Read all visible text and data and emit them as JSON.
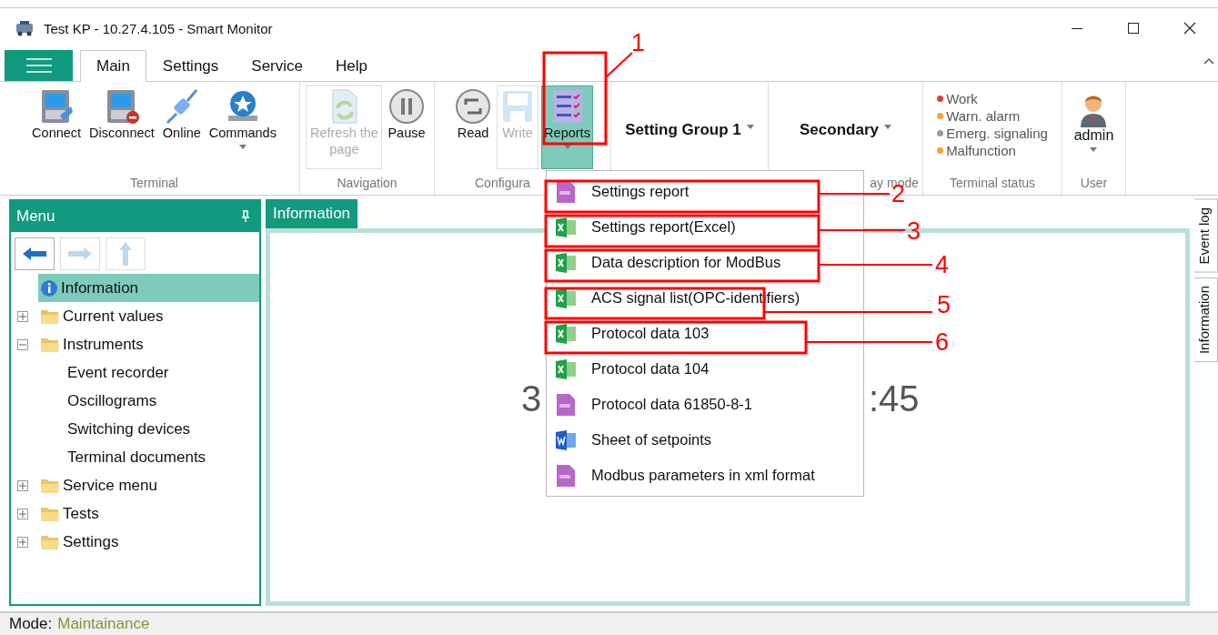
{
  "window": {
    "title": "Test KP - 10.27.4.105 - Smart Monitor"
  },
  "tabs": [
    {
      "label": "Main",
      "selected": true
    },
    {
      "label": "Settings",
      "selected": false
    },
    {
      "label": "Service",
      "selected": false
    },
    {
      "label": "Help",
      "selected": false
    }
  ],
  "ribbon": {
    "groups": [
      {
        "label": "Terminal",
        "kind": "buttons",
        "buttons": [
          {
            "label": "Connect",
            "disabled": false,
            "selected": false
          },
          {
            "label": "Disconnect",
            "disabled": false,
            "selected": false
          },
          {
            "label": "Online",
            "disabled": false,
            "selected": false
          },
          {
            "label": "Commands",
            "disabled": false,
            "selected": false,
            "dropdown": true
          }
        ]
      },
      {
        "label": "Navigation",
        "kind": "buttons",
        "buttons": [
          {
            "label": "Refresh the page",
            "disabled": true,
            "selected": false
          },
          {
            "label": "Pause",
            "disabled": false,
            "selected": false
          }
        ]
      },
      {
        "label": "Configura",
        "kind": "buttons",
        "buttons": [
          {
            "label": "Read",
            "disabled": false,
            "selected": false
          },
          {
            "label": "Write",
            "disabled": true,
            "selected": false
          },
          {
            "label": "Reports",
            "disabled": false,
            "selected": true,
            "dropdown": true
          }
        ]
      },
      {
        "kind": "select",
        "value": "Setting Group 1"
      },
      {
        "label": "ay mode",
        "kind": "select",
        "value": "Secondary"
      },
      {
        "label": "Terminal status",
        "kind": "status",
        "items": [
          {
            "label": "Work",
            "color": "#e83a3a"
          },
          {
            "label": "Warn. alarm",
            "color": "#f5a623"
          },
          {
            "label": "Emerg. signaling",
            "color": "#9a9a9a"
          },
          {
            "label": "Malfunction",
            "color": "#f5a623"
          }
        ]
      },
      {
        "label": "User",
        "kind": "user",
        "value": "admin"
      }
    ]
  },
  "menu_panel": {
    "title": "Menu",
    "nav": [
      {
        "disabled": false
      },
      {
        "disabled": true
      },
      {
        "disabled": true
      }
    ],
    "tree": [
      {
        "label": "Information",
        "kind": "info",
        "selected": true
      },
      {
        "label": "Current values",
        "kind": "folder",
        "expanded": false,
        "selected": false
      },
      {
        "label": "Instruments",
        "kind": "folder",
        "expanded": true,
        "selected": false,
        "children": [
          {
            "label": "Event recorder",
            "selected": false
          },
          {
            "label": "Oscillograms",
            "selected": false
          },
          {
            "label": "Switching devices",
            "selected": false
          },
          {
            "label": "Terminal documents",
            "selected": false
          }
        ]
      },
      {
        "label": "Service menu",
        "kind": "folder",
        "expanded": false,
        "selected": false
      },
      {
        "label": "Tests",
        "kind": "folder",
        "expanded": false,
        "selected": false
      },
      {
        "label": "Settings",
        "kind": "folder",
        "expanded": false,
        "selected": false
      }
    ]
  },
  "info_panel": {
    "tab": "Information",
    "time_fragments": [
      "3",
      ":45"
    ]
  },
  "side_tabs": [
    "Event log",
    "Information"
  ],
  "reports_menu": [
    {
      "label": "Settings report",
      "kind": "txt"
    },
    {
      "label": "Settings report(Excel)",
      "kind": "excel"
    },
    {
      "label": "Data description for ModBus",
      "kind": "excel"
    },
    {
      "label": "ACS signal list(OPC-identifiers)",
      "kind": "excel"
    },
    {
      "label": "Protocol data 103",
      "kind": "excel"
    },
    {
      "label": "Protocol data 104",
      "kind": "excel"
    },
    {
      "label": "Protocol data 61850-8-1",
      "kind": "txt"
    },
    {
      "label": "Sheet of setpoints",
      "kind": "word"
    },
    {
      "label": "Modbus parameters in xml format",
      "kind": "txt"
    }
  ],
  "annotations": [
    "1",
    "2",
    "3",
    "4",
    "5",
    "6"
  ],
  "status_bar": {
    "label": "Mode:",
    "value": "Maintainance"
  }
}
